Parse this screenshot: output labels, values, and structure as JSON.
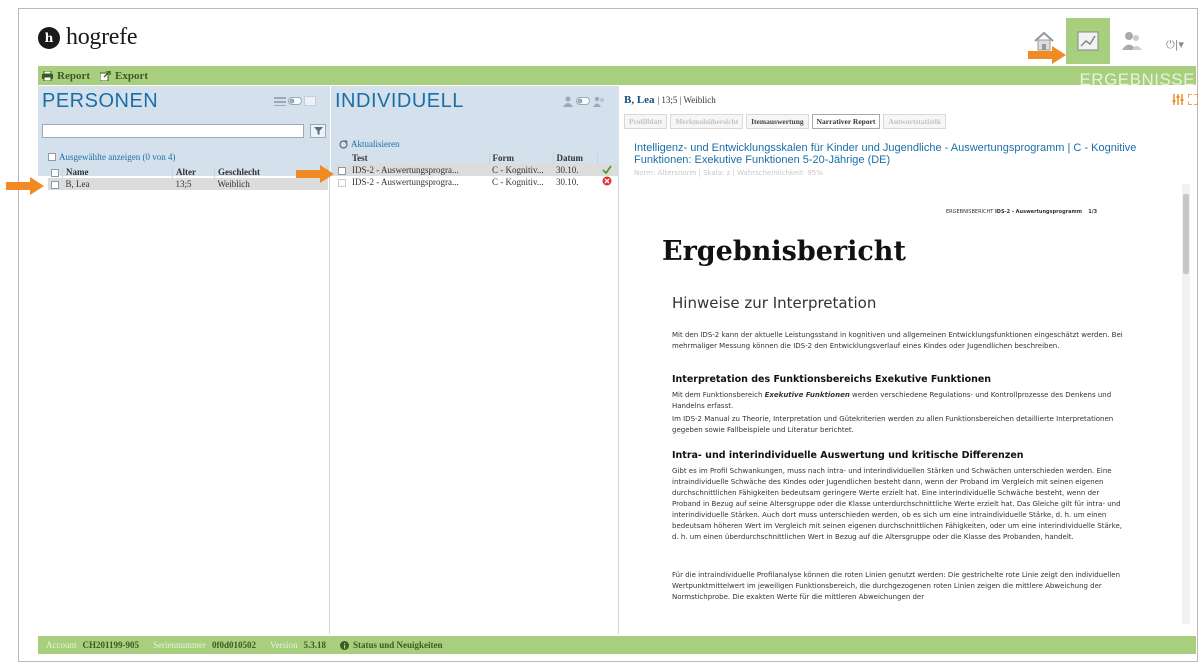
{
  "header": {
    "logo_mark": "h",
    "logo_text": "hogrefe",
    "power_glyph": "⏻|▾"
  },
  "nav": [
    {
      "icon": "home-icon"
    },
    {
      "icon": "chart-icon",
      "active": true
    },
    {
      "icon": "users-icon"
    }
  ],
  "toolbar": {
    "report_label": "Report",
    "export_label": "Export",
    "section_label": "ERGEBNISSE"
  },
  "personen": {
    "title": "PERSONEN",
    "search_value": "",
    "selected_link": "Ausgewählte anzeigen (0 von 4)",
    "columns": [
      "Name",
      "Alter",
      "Geschlecht"
    ],
    "rows": [
      {
        "name": "B, Lea",
        "alter": "13;5",
        "geschlecht": "Weiblich"
      }
    ]
  },
  "individuell": {
    "title": "INDIVIDUELL",
    "refresh_label": "Aktualisieren",
    "columns": [
      "Test",
      "Form",
      "Datum"
    ],
    "rows": [
      {
        "test": "IDS-2 - Auswertungsprogra...",
        "form": "C - Kognitiv...",
        "datum": "30.10.",
        "status": "ok"
      },
      {
        "test": "IDS-2 - Auswertungsprogra...",
        "form": "C - Kognitiv...",
        "datum": "30.10.",
        "status": "error"
      }
    ]
  },
  "report": {
    "person_name": "B, Lea",
    "person_meta": "| 13;5 | Weiblich",
    "tabs": [
      "Profilblatt",
      "Merkmalsübersicht",
      "Itemauswertung",
      "Narrativer Report",
      "Antwortstatistik"
    ],
    "active_tab": "Narrativer Report",
    "title": "Intelligenz- und Entwicklungsskalen für Kinder und Jugendliche - Auswertungsprogramm | C - Kognitive Funktionen: Exekutive Funktionen 5-20-Jährige (DE)",
    "norm_line": "Norm: Altersnorm | Skala: z | Wahrscheinlichkeit: 95%",
    "document": {
      "header_label": "ERGEBNISBERICHT",
      "header_test": "IDS-2 - Auswertungsprogramm",
      "page": "1/3",
      "heading": "Ergebnisbericht",
      "subheading": "Hinweise zur Interpretation",
      "intro": "Mit den IDS-2 kann der aktuelle Leistungsstand in kognitiven und allgemeinen Entwicklungsfunktionen eingeschätzt werden. Bei mehrmaliger Messung können die IDS-2 den Entwicklungsverlauf eines Kindes oder Jugendlichen beschreiben.",
      "section1_title": "Interpretation des Funktionsbereichs Exekutive Funktionen",
      "section1_p1_pre": "Mit dem Funktionsbereich",
      "section1_p1_em": "Exekutive Funktionen",
      "section1_p1_post": "werden verschiedene Regulations- und Kontrollprozesse des Denkens und Handelns erfasst.",
      "section1_p2": "Im IDS-2 Manual zu Theorie, Interpretation und Gütekriterien werden zu allen Funktionsbereichen detaillierte Interpretationen gegeben sowie Fallbeispiele und Literatur berichtet.",
      "section2_title": "Intra- und interindividuelle Auswertung und kritische Differenzen",
      "section2_p1": "Gibt es im Profil Schwankungen, muss nach intra- und interindividuellen Stärken und Schwächen unterschieden werden. Eine intraindividuelle Schwäche des Kindes oder Jugendlichen besteht dann, wenn der Proband im Vergleich mit seinen eigenen durchschnittlichen Fähigkeiten bedeutsam geringere Werte erzielt hat. Eine interindividuelle Schwäche besteht, wenn der Proband in Bezug auf seine Altersgruppe oder die Klasse unterdurchschnittliche Werte erzielt hat. Das Gleiche gilt für intra- und interindividuelle Stärken. Auch dort muss unterschieden werden, ob es sich um eine intraindividuelle Stärke, d. h. um einen bedeutsam höheren Wert im Vergleich mit seinen eigenen durchschnittlichen Fähigkeiten, oder um eine interindividuelle Stärke, d. h. um einen überdurchschnittlichen Wert in Bezug auf die Altersgruppe oder die Klasse des Probanden, handelt.",
      "section2_p2": "Für die intraindividuelle Profilanalyse können die roten Linien genutzt werden: Die gestrichelte rote Linie zeigt den individuellen Wertpunktmittelwert im jeweiligen Funktionsbereich, die durchgezogenen roten Linien zeigen die mittlere Abweichung der Normstichprobe. Die exakten Werte für die mittleren Abweichungen der"
    }
  },
  "status": {
    "account_label": "Account",
    "account_value": "CH201199-905",
    "serial_label": "Seriennummer",
    "serial_value": "0f0d010502",
    "version_label": "Version",
    "version_value": "5.3.18",
    "news_label": "Status und Neuigkeiten"
  },
  "colors": {
    "accent_green": "#a8cf7d",
    "panel_blue": "#d4e1ec",
    "title_blue": "#1a6fa8",
    "arrow_orange": "#f08a24"
  }
}
